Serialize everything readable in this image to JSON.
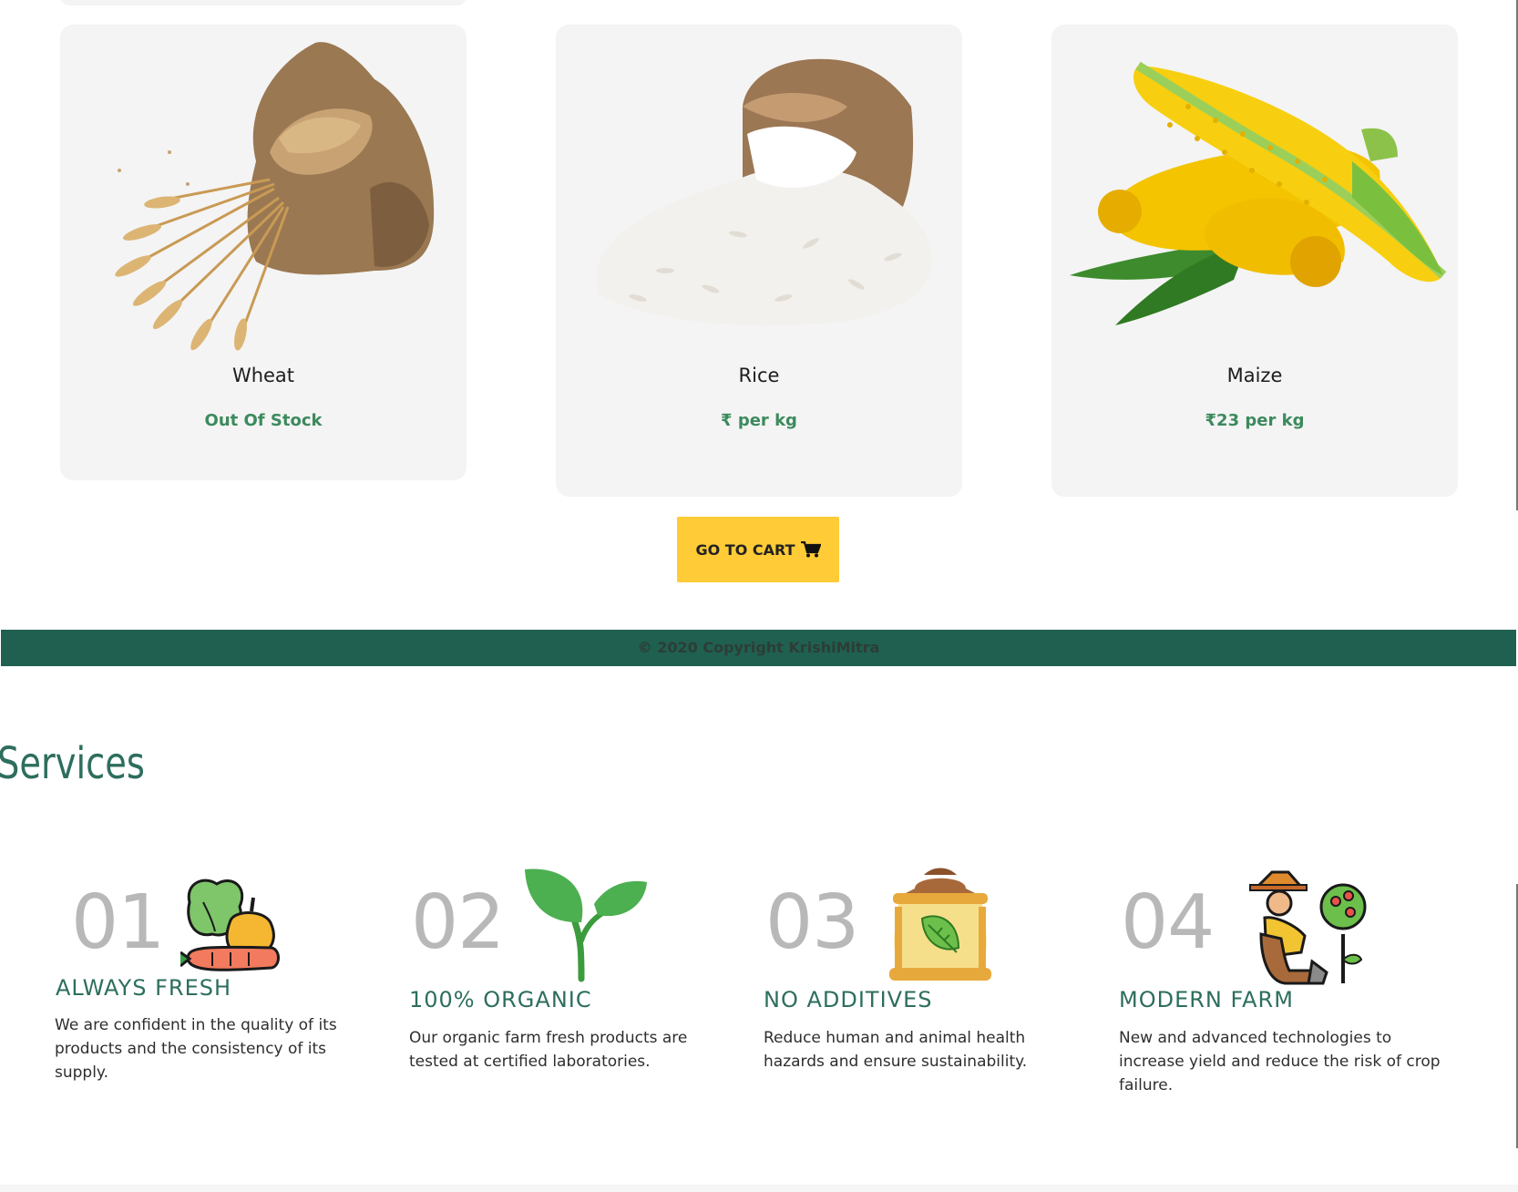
{
  "products": [
    {
      "name": "Wheat",
      "price": "Out Of Stock",
      "image_icon": "wheat-sack-image"
    },
    {
      "name": "Rice",
      "price": "₹ per kg",
      "image_icon": "rice-sack-image"
    },
    {
      "name": "Maize",
      "price": "₹23 per kg",
      "image_icon": "corn-cob-image"
    }
  ],
  "cart_button": {
    "label": "GO TO CART",
    "icon": "cart-icon"
  },
  "footer": {
    "copyright": "© 2020 Copyright KrishiMitra"
  },
  "services": {
    "title": "Services",
    "items": [
      {
        "number": "01",
        "title": "ALWAYS FRESH",
        "description": "We are confident in the quality of its products and the consistency of its supply.",
        "icon": "vegetables-icon"
      },
      {
        "number": "02",
        "title": "100% ORGANIC",
        "description": "Our organic farm fresh products are tested at certified laboratories.",
        "icon": "sprout-icon"
      },
      {
        "number": "03",
        "title": "NO ADDITIVES",
        "description": "Reduce human and animal health hazards and ensure sustainability.",
        "icon": "grain-sack-icon"
      },
      {
        "number": "04",
        "title": "MODERN FARM",
        "description": "New and advanced technologies to increase yield and reduce the risk of crop failure.",
        "icon": "farmer-icon"
      }
    ]
  },
  "colors": {
    "accent_green": "#3c8a5d",
    "heading_green": "#2d6e5e",
    "footer_green": "#1f6050",
    "button_yellow": "#ffcb37",
    "card_bg": "#f4f4f4"
  }
}
